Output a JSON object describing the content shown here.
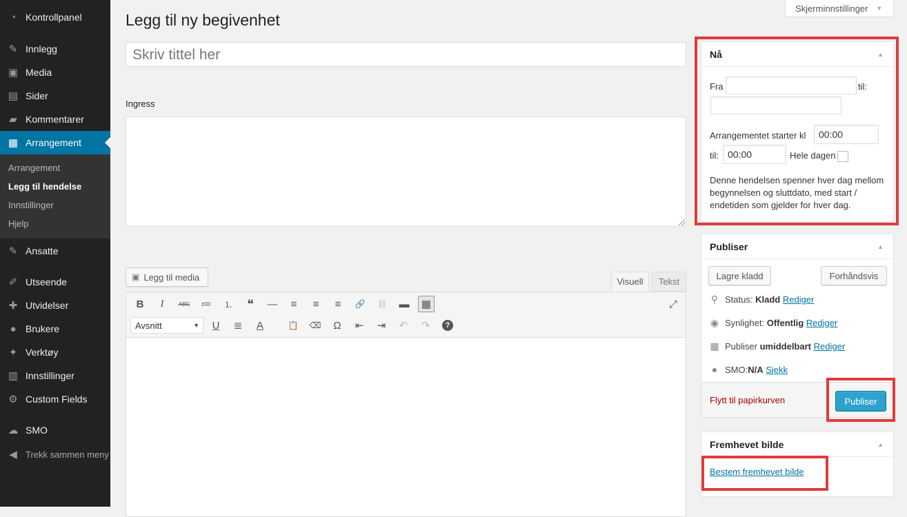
{
  "sidebar": {
    "items": [
      {
        "label": "Kontrollpanel",
        "icon": "dashboard-icon"
      },
      {
        "label": "Innlegg",
        "icon": "pin-icon"
      },
      {
        "label": "Media",
        "icon": "media-icon"
      },
      {
        "label": "Sider",
        "icon": "page-icon"
      },
      {
        "label": "Kommentarer",
        "icon": "comment-icon"
      },
      {
        "label": "Arrangement",
        "icon": "calendar-icon"
      },
      {
        "label": "Ansatte",
        "icon": "pin-icon"
      },
      {
        "label": "Utseende",
        "icon": "brush-icon"
      },
      {
        "label": "Utvidelser",
        "icon": "plugin-icon"
      },
      {
        "label": "Brukere",
        "icon": "users-icon"
      },
      {
        "label": "Verktøy",
        "icon": "wrench-icon"
      },
      {
        "label": "Innstillinger",
        "icon": "settings-icon"
      },
      {
        "label": "Custom Fields",
        "icon": "gear-icon"
      },
      {
        "label": "SMO",
        "icon": "smo-icon"
      }
    ],
    "submenu": [
      "Arrangement",
      "Legg til hendelse",
      "Innstillinger",
      "Hjelp"
    ],
    "collapse": "Trekk sammen meny"
  },
  "screen_options": "Skjerminnstillinger",
  "page_title": "Legg til ny begivenhet",
  "title_placeholder": "Skriv tittel her",
  "ingress_label": "Ingress",
  "editor": {
    "add_media": "Legg til media",
    "tab_visual": "Visuell",
    "tab_text": "Tekst",
    "format": "Avsnitt",
    "buttons_row1": [
      "B",
      "I",
      "ABC",
      "≔",
      "⒈",
      "❝",
      "—",
      "≡",
      "≡",
      "≡",
      "🔗",
      "⛓",
      "▬",
      "▦"
    ],
    "buttons_row2": [
      "U",
      "≣",
      "A",
      "📋",
      "⌫",
      "Ω",
      "⇤",
      "⇥",
      "↶",
      "↷",
      "?"
    ],
    "fullscreen": "⤢"
  },
  "now_box": {
    "title": "Nå",
    "from_label": "Fra",
    "to_label": "til:",
    "starts_label": "Arrangementet starter kl",
    "start_time": "00:00",
    "until_label": "til:",
    "end_time": "00:00",
    "all_day": "Hele dagen",
    "note": "Denne hendelsen spenner hver dag mellom begynnelsen og sluttdato, med start / endetiden som gjelder for hver dag."
  },
  "publish_box": {
    "title": "Publiser",
    "save_draft": "Lagre kladd",
    "preview": "Forhåndsvis",
    "status_label": "Status:",
    "status_value": "Kladd",
    "visibility_label": "Synlighet:",
    "visibility_value": "Offentlig",
    "publish_label": "Publiser",
    "publish_value": "umiddelbart",
    "smo_label": "SMO:",
    "smo_value": "N/A",
    "smo_link": "Sjekk",
    "edit": "Rediger",
    "trash": "Flytt til papirkurven",
    "publish_button": "Publiser"
  },
  "featured_box": {
    "title": "Fremhevet bilde",
    "link": "Bestem fremhevet bilde"
  },
  "colors": {
    "sidebar": "#222222",
    "accent": "#0074a2",
    "publish": "#2ea2cc",
    "highlight": "#e03c3c"
  }
}
